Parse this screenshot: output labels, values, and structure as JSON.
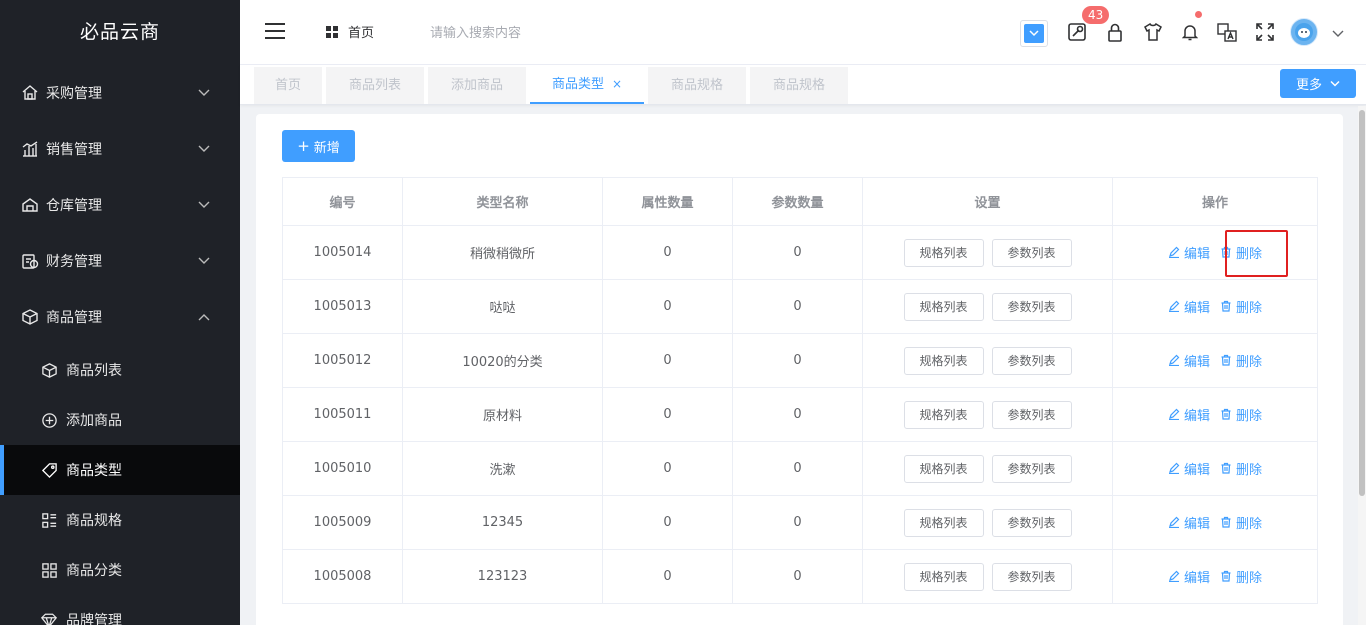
{
  "app": {
    "title": "必品云商"
  },
  "sidebar": {
    "menus": [
      {
        "label": "采购管理",
        "icon": "house-icon",
        "expanded": false
      },
      {
        "label": "销售管理",
        "icon": "chart-icon",
        "expanded": false
      },
      {
        "label": "仓库管理",
        "icon": "warehouse-icon",
        "expanded": false
      },
      {
        "label": "财务管理",
        "icon": "finance-icon",
        "expanded": false
      },
      {
        "label": "商品管理",
        "icon": "cube-icon",
        "expanded": true
      }
    ],
    "submenu": [
      {
        "label": "商品列表",
        "icon": "cube-icon"
      },
      {
        "label": "添加商品",
        "icon": "plus-circle-icon"
      },
      {
        "label": "商品类型",
        "icon": "tag-icon",
        "active": true
      },
      {
        "label": "商品规格",
        "icon": "list-icon"
      },
      {
        "label": "商品分类",
        "icon": "grid-icon"
      },
      {
        "label": "品牌管理",
        "icon": "diamond-icon"
      }
    ]
  },
  "header": {
    "breadcrumb": "首页",
    "search_placeholder": "请输入搜索内容",
    "badge_count": "43",
    "icons": [
      "menu-icon",
      "theme-icon",
      "tools-icon",
      "lock-icon",
      "shirt-icon",
      "bell-icon",
      "translate-icon",
      "fullscreen-icon",
      "avatar",
      "chevron-down-icon"
    ]
  },
  "tabs": {
    "items": [
      {
        "label": "首页"
      },
      {
        "label": "商品列表"
      },
      {
        "label": "添加商品"
      },
      {
        "label": "商品类型",
        "active": true,
        "close": "×"
      },
      {
        "label": "商品规格"
      },
      {
        "label": "商品规格"
      }
    ],
    "more_label": "更多"
  },
  "main": {
    "add_label": "新增",
    "table": {
      "headers": [
        "编号",
        "类型名称",
        "属性数量",
        "参数数量",
        "设置",
        "操作"
      ],
      "spec_btn": "规格列表",
      "param_btn": "参数列表",
      "edit_label": "编辑",
      "delete_label": "删除",
      "rows": [
        {
          "id": "1005014",
          "name": "稍微稍微所",
          "attrs": "0",
          "params": "0"
        },
        {
          "id": "1005013",
          "name": "哒哒",
          "attrs": "0",
          "params": "0"
        },
        {
          "id": "1005012",
          "name": "10020的分类",
          "attrs": "0",
          "params": "0"
        },
        {
          "id": "1005011",
          "name": "原材料",
          "attrs": "0",
          "params": "0"
        },
        {
          "id": "1005010",
          "name": "洗漱",
          "attrs": "0",
          "params": "0"
        },
        {
          "id": "1005009",
          "name": "12345",
          "attrs": "0",
          "params": "0"
        },
        {
          "id": "1005008",
          "name": "123123",
          "attrs": "0",
          "params": "0"
        }
      ]
    }
  },
  "colors": {
    "accent": "#409eff",
    "sidebar_bg": "#1f2228",
    "highlight": "#e02020",
    "badge": "#f56c6c"
  }
}
